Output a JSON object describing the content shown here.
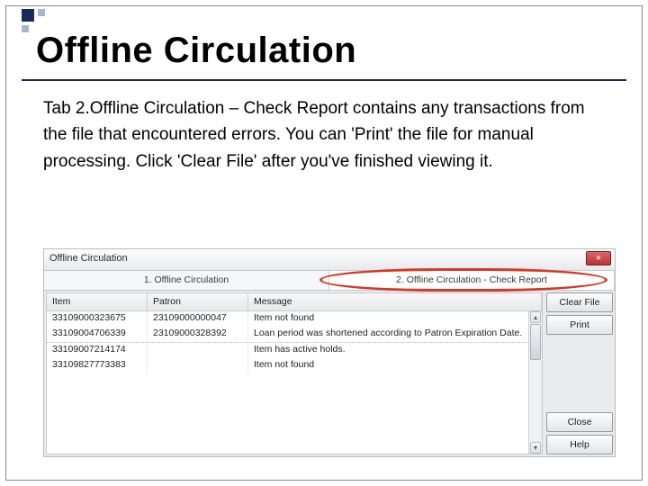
{
  "slide": {
    "title": "Offline Circulation",
    "body": "Tab 2.Offline Circulation – Check Report contains any transactions from the file that encountered errors.  You can 'Print' the file for manual processing.  Click 'Clear File' after you've finished viewing it."
  },
  "window": {
    "title": "Offline Circulation",
    "close_glyph": "×",
    "tabs": [
      {
        "label": "1. Offline Circulation"
      },
      {
        "label": "2. Offline Circulation - Check Report"
      }
    ],
    "columns": {
      "item": "Item",
      "patron": "Patron",
      "message": "Message"
    },
    "rows": [
      {
        "item": "33109000323675",
        "patron": "23109000000047",
        "message": "Item not found"
      },
      {
        "item": "33109004706339",
        "patron": "23109000328392",
        "message": "Loan period was shortened according to Patron Expiration Date."
      },
      {
        "item": "33109007214174",
        "patron": "",
        "message": "Item has active holds."
      },
      {
        "item": "33109827773383",
        "patron": "",
        "message": "Item not found"
      }
    ],
    "buttons": {
      "clear_file": "Clear File",
      "print": "Print",
      "close": "Close",
      "help": "Help"
    }
  }
}
